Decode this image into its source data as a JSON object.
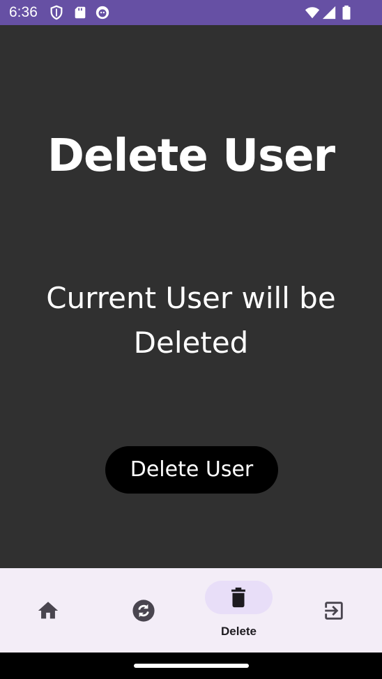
{
  "status_bar": {
    "time": "6:36",
    "left_icons": [
      "shield-icon",
      "sd-card-icon",
      "app-notification-icon"
    ],
    "right_icons": [
      "wifi-icon",
      "cellular-signal-icon",
      "battery-icon"
    ],
    "background_color": "#6650a4"
  },
  "main": {
    "title": "Delete User",
    "description": "Current User will be Deleted",
    "button_label": "Delete User",
    "background_color": "#303030"
  },
  "bottom_nav": {
    "items": [
      {
        "icon": "home-icon",
        "label": "",
        "active": false
      },
      {
        "icon": "sync-icon",
        "label": "",
        "active": false
      },
      {
        "icon": "trash-icon",
        "label": "Delete",
        "active": true
      },
      {
        "icon": "exit-icon",
        "label": "",
        "active": false
      }
    ],
    "background_color": "#f3edf7",
    "active_indicator_color": "#e8def8"
  }
}
